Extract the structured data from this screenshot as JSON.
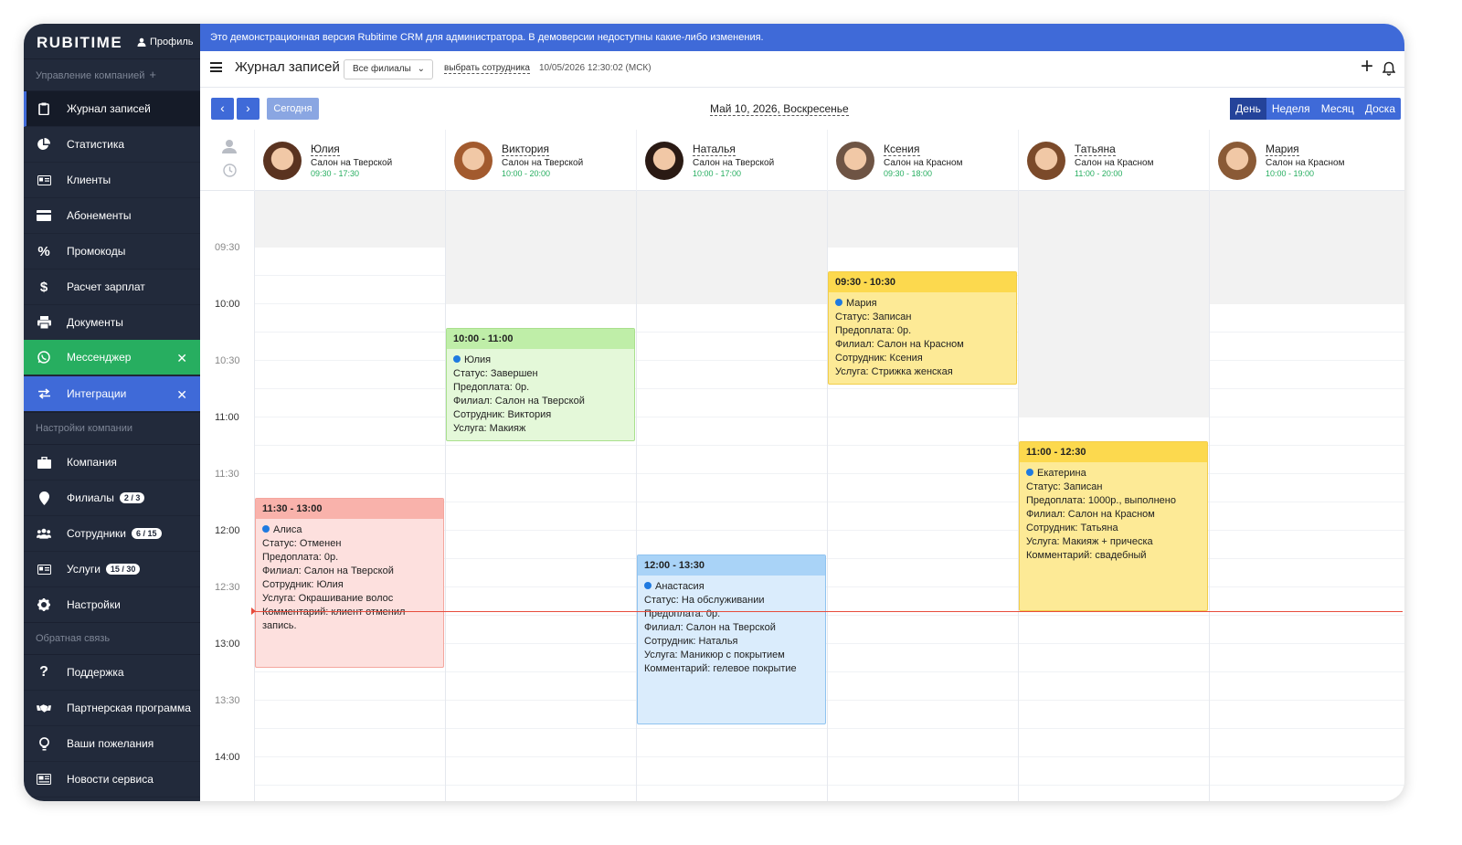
{
  "brand": "RUBITIME",
  "profile_label": "Профиль",
  "sidebar": {
    "section_company": "Управление компанией",
    "section_settings": "Настройки компании",
    "section_feedback": "Обратная связь",
    "items": [
      {
        "label": "Журнал записей",
        "icon": "clipboard-icon"
      },
      {
        "label": "Статистика",
        "icon": "pie-chart-icon"
      },
      {
        "label": "Клиенты",
        "icon": "id-card-icon"
      },
      {
        "label": "Абонементы",
        "icon": "credit-card-icon"
      },
      {
        "label": "Промокоды",
        "icon": "percent-icon"
      },
      {
        "label": "Расчет зарплат",
        "icon": "dollar-icon"
      },
      {
        "label": "Документы",
        "icon": "printer-icon"
      },
      {
        "label": "Мессенджер",
        "icon": "whatsapp-icon"
      },
      {
        "label": "Интеграции",
        "icon": "exchange-icon"
      }
    ],
    "settings_items": [
      {
        "label": "Компания",
        "icon": "briefcase-icon"
      },
      {
        "label": "Филиалы",
        "count": "2 / 3",
        "icon": "map-pin-icon"
      },
      {
        "label": "Сотрудники",
        "count": "6 / 15",
        "icon": "users-icon"
      },
      {
        "label": "Услуги",
        "count": "15 / 30",
        "icon": "list-icon"
      },
      {
        "label": "Настройки",
        "icon": "gear-icon"
      }
    ],
    "feedback_items": [
      {
        "label": "Поддержка",
        "icon": "question-icon"
      },
      {
        "label": "Партнерская программа",
        "icon": "handshake-icon"
      },
      {
        "label": "Ваши пожелания",
        "icon": "lightbulb-icon"
      },
      {
        "label": "Новости сервиса",
        "icon": "newspaper-icon"
      }
    ]
  },
  "banner": "Это демонстрационная версия Rubitime CRM для администратора. В демоверсии недоступны какие-либо изменения.",
  "toolbar": {
    "title": "Журнал записей",
    "branch_select": "Все филиалы",
    "employee_link": "выбрать сотрудника",
    "datetime": "10/05/2026 12:30:02 (МСК)"
  },
  "nav": {
    "prev": "‹",
    "next": "›",
    "today": "Сегодня",
    "current_date": "Май 10, 2026, Воскресенье",
    "views": [
      "День",
      "Неделя",
      "Месяц",
      "Доска"
    ],
    "active_view": "День"
  },
  "staff": [
    {
      "name": "Юлия",
      "branch": "Салон на Тверской",
      "hours": "09:30 - 17:30"
    },
    {
      "name": "Виктория",
      "branch": "Салон на Тверской",
      "hours": "10:00 - 20:00"
    },
    {
      "name": "Наталья",
      "branch": "Салон на Тверской",
      "hours": "10:00 - 17:00"
    },
    {
      "name": "Ксения",
      "branch": "Салон на Красном",
      "hours": "09:30 - 18:00"
    },
    {
      "name": "Татьяна",
      "branch": "Салон на Красном",
      "hours": "11:00 - 20:00"
    },
    {
      "name": "Мария",
      "branch": "Салон на Красном",
      "hours": "10:00 - 19:00"
    }
  ],
  "times": [
    "09:30",
    "10:00",
    "10:30",
    "11:00",
    "11:30",
    "12:00",
    "12:30",
    "13:00",
    "13:30",
    "14:00"
  ],
  "events": [
    {
      "time": "11:30 - 13:00",
      "client": "Алиса",
      "status": "Статус: Отменен",
      "prepay": "Предоплата: 0р.",
      "branch": "Филиал: Салон на Тверской",
      "staff": "Сотрудник: Юлия",
      "service": "Услуга: Окрашивание волос",
      "comment": "Комментарий: клиент отменил запись.",
      "bg": "#fde0de",
      "head": "#f9b2ab",
      "border": "#f4a69e"
    },
    {
      "time": "10:00 - 11:00",
      "client": "Юлия",
      "status": "Статус: Завершен",
      "prepay": "Предоплата: 0р.",
      "branch": "Филиал: Салон на Тверской",
      "staff": "Сотрудник: Виктория",
      "service": "Услуга: Макияж",
      "comment": "",
      "bg": "#e4f8d9",
      "head": "#bfeea8",
      "border": "#a9e08d"
    },
    {
      "time": "12:00 - 13:30",
      "client": "Анастасия",
      "status": "Статус: На обслуживании",
      "prepay": "Предоплата: 0р.",
      "branch": "Филиал: Салон на Тверской",
      "staff": "Сотрудник: Наталья",
      "service": "Услуга: Маникюр с покрытием",
      "comment": "Комментарий: гелевое покрытие",
      "bg": "#daecfc",
      "head": "#a9d3f7",
      "border": "#8fc3f0"
    },
    {
      "time": "09:30 - 10:30",
      "client": "Мария",
      "status": "Статус: Записан",
      "prepay": "Предоплата: 0р.",
      "branch": "Филиал: Салон на Красном",
      "staff": "Сотрудник: Ксения",
      "service": "Услуга: Стрижка женская",
      "comment": "",
      "bg": "#fdea96",
      "head": "#fcd94e",
      "border": "#f2cd4a"
    },
    {
      "time": "11:00 - 12:30",
      "client": "Екатерина",
      "status": "Статус: Записан",
      "prepay": "Предоплата: 1000р., выполнено",
      "branch": "Филиал: Салон на Красном",
      "staff": "Сотрудник: Татьяна",
      "service": "Услуга: Макияж + прическа",
      "comment": "Комментарий: свадебный",
      "bg": "#fdea96",
      "head": "#fcd94e",
      "border": "#f2cd4a"
    }
  ],
  "colors": {
    "sidebar": "#222a3b",
    "accent": "#3f6ad8",
    "messenger": "#27ae60",
    "now_line": "#e74c3c"
  }
}
